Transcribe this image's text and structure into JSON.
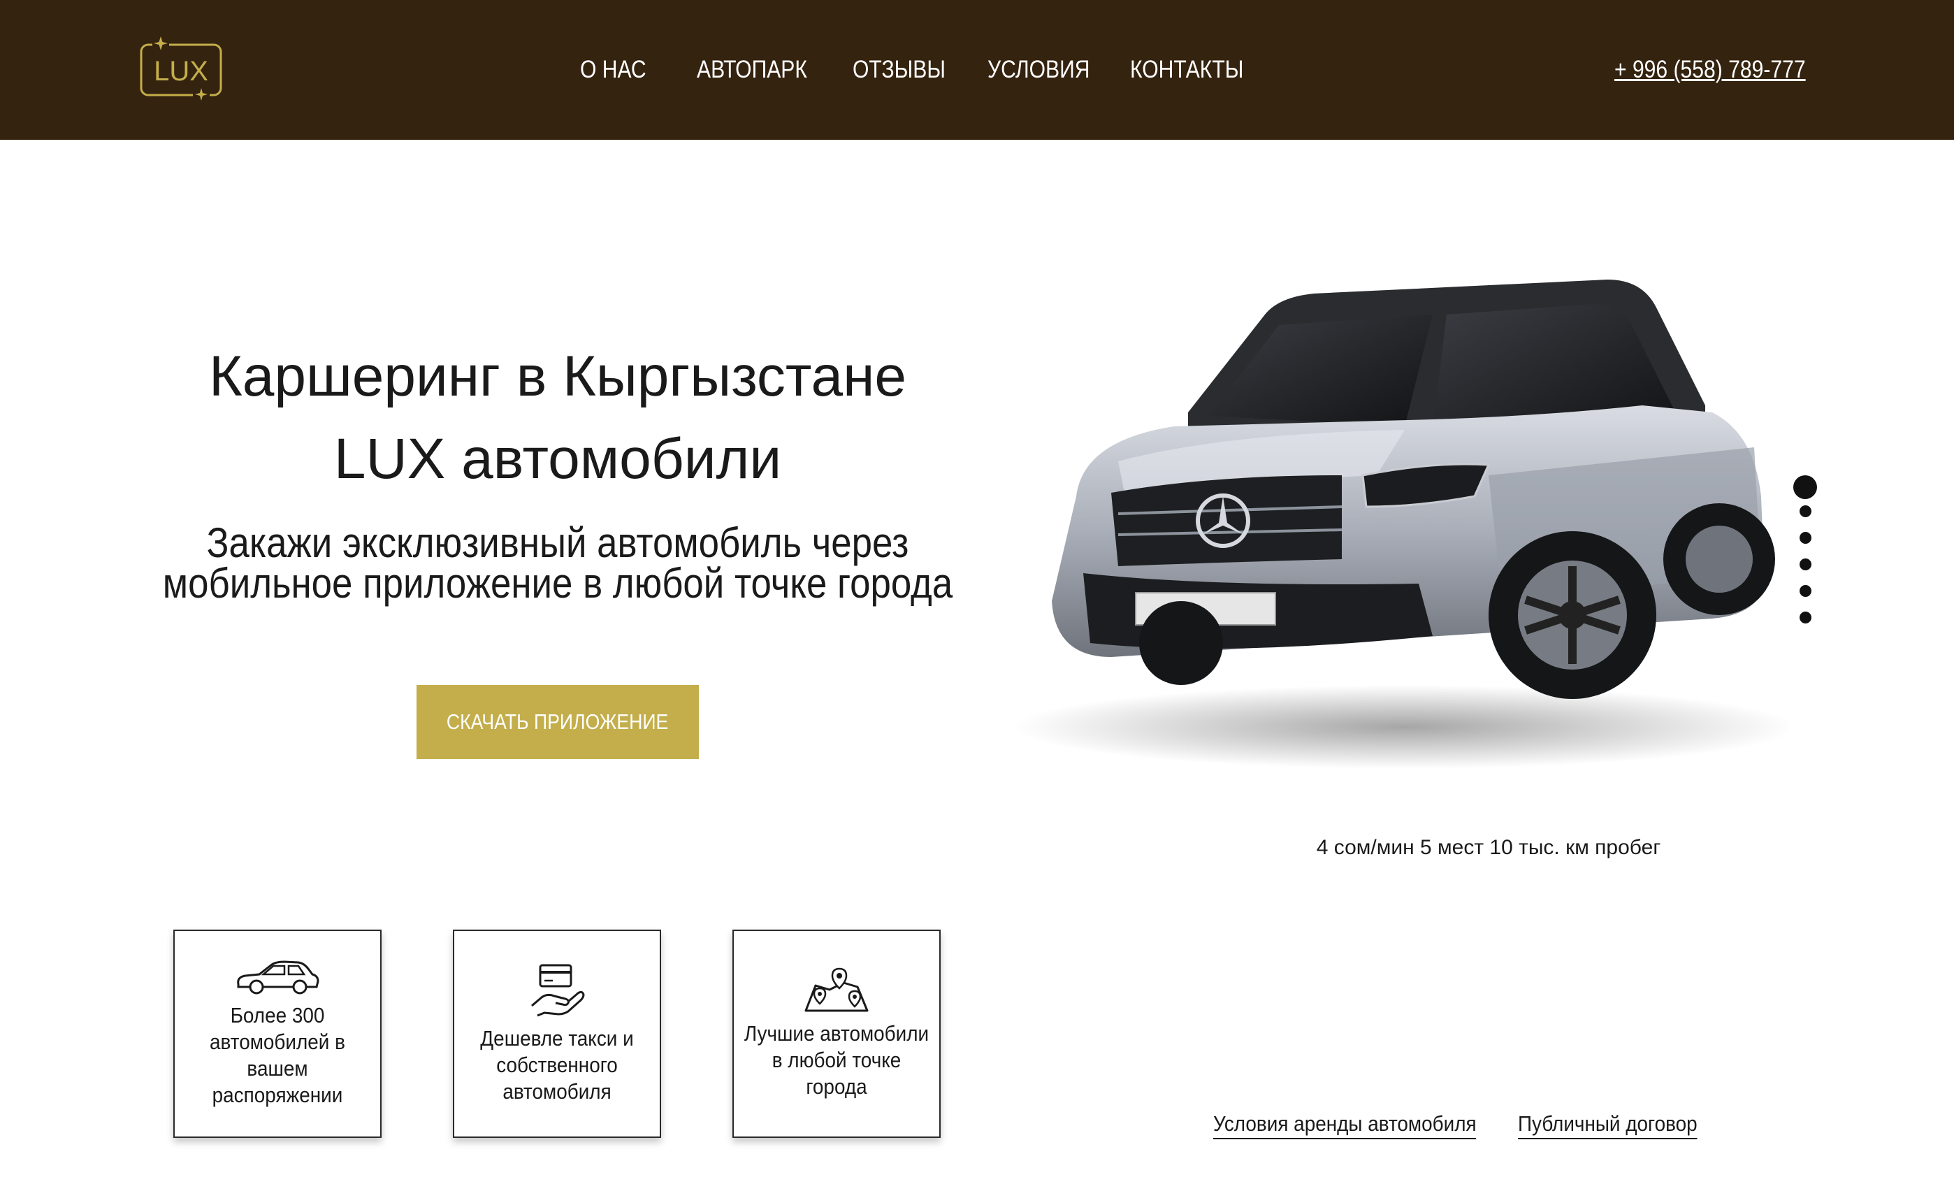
{
  "header": {
    "logo_text": "LUX",
    "nav": [
      "О НАС",
      "АВТОПАРК",
      "ОТЗЫВЫ",
      "УСЛОВИЯ",
      "КОНТАКТЫ"
    ],
    "phone": "+ 996 (558) 789-777"
  },
  "hero": {
    "title_line1": "Каршеринг в Кыргызстане",
    "title_line2": "LUX автомобили",
    "subtitle_line1": "Закажи эксклюзивный автомобиль через",
    "subtitle_line2": "мобильное приложение в любой точке города",
    "cta_label": "СКАЧАТЬ ПРИЛОЖЕНИЕ"
  },
  "car": {
    "specs": "4 сом/мин 5 мест 10 тыс. км пробег",
    "slides_total": 6,
    "active_slide": 1
  },
  "features": [
    {
      "icon": "car-icon",
      "text": "Более 300 автомобилей в вашем распоряжении"
    },
    {
      "icon": "card-hand-icon",
      "text": "Дешевле такси и собственного автомобиля"
    },
    {
      "icon": "map-pins-icon",
      "text": "Лучшие автомобили в любой точке города"
    }
  ],
  "footer_links": [
    "Условия аренды автомобиля",
    "Публичный договор"
  ],
  "colors": {
    "header_bg": "#34230f",
    "accent_gold": "#c3ae4b",
    "text": "#1a1a1a"
  }
}
